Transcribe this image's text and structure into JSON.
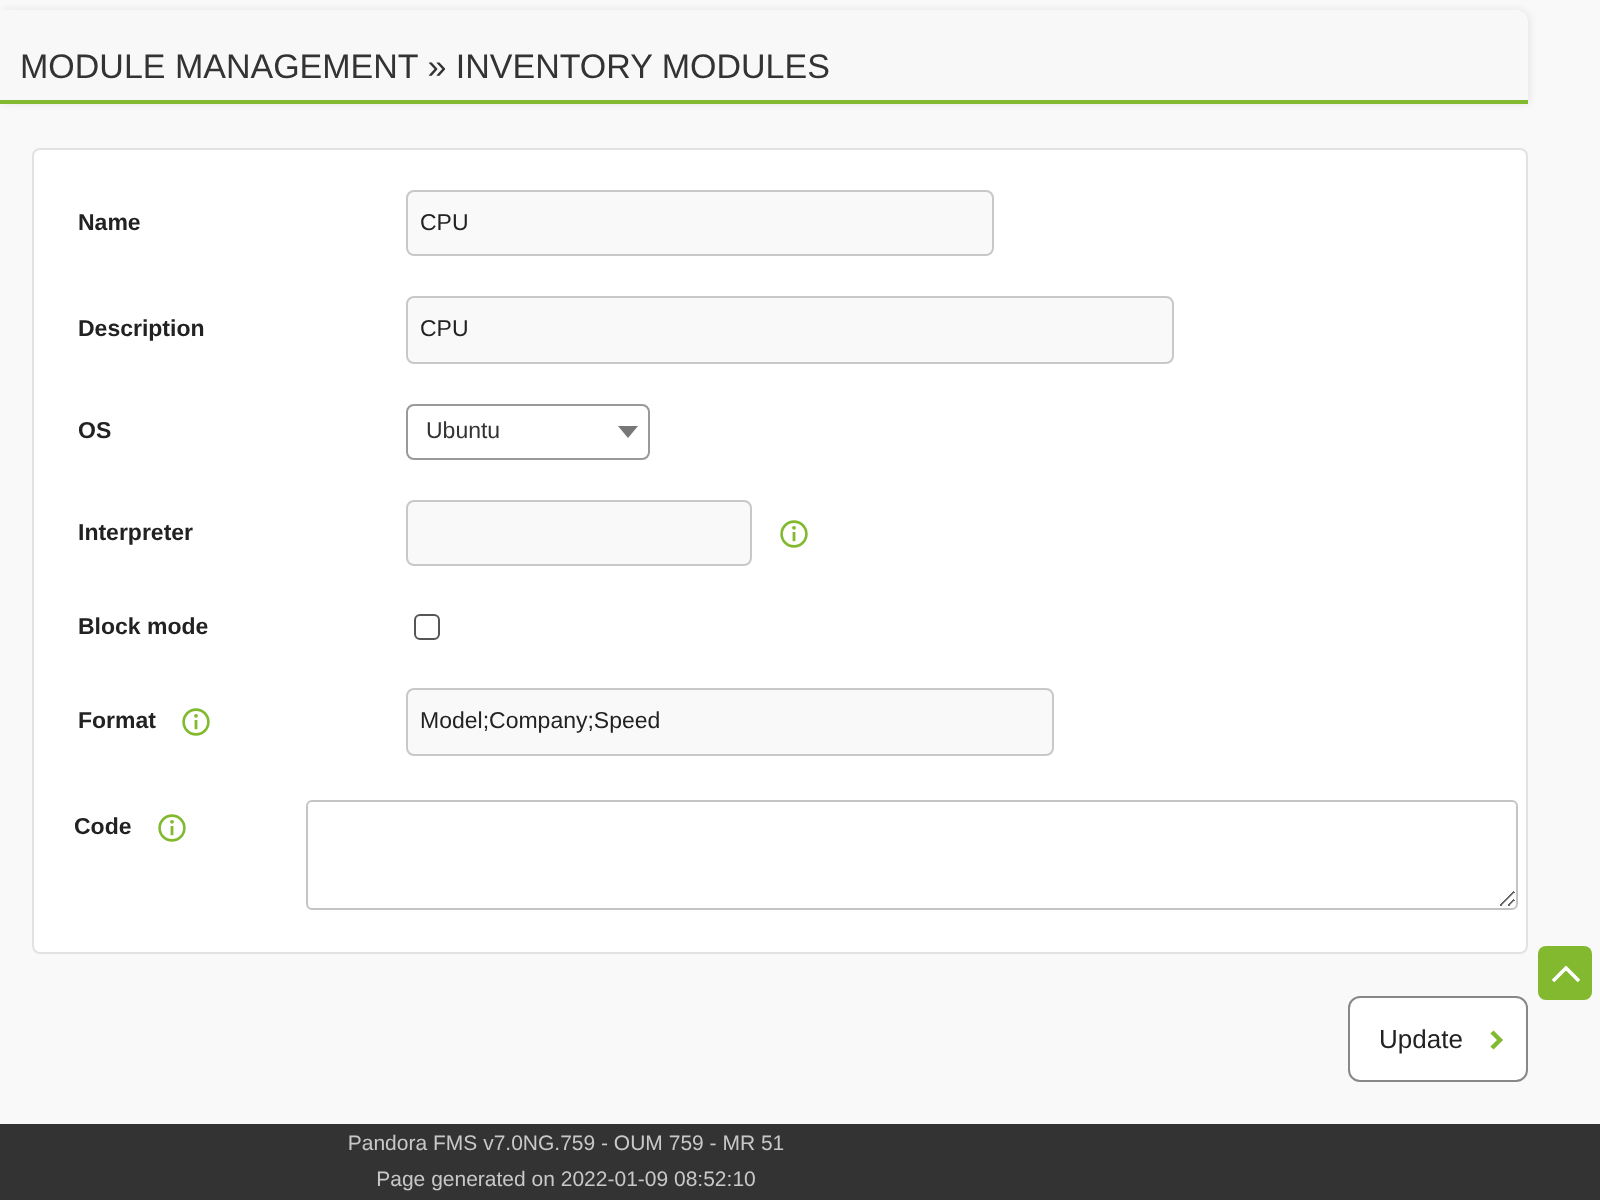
{
  "header": {
    "title": "MODULE MANAGEMENT » INVENTORY MODULES"
  },
  "form": {
    "fields": [
      {
        "kind": "text",
        "label": "Name",
        "value": "CPU"
      },
      {
        "kind": "text",
        "label": "Description",
        "value": "CPU"
      },
      {
        "kind": "select",
        "label": "OS",
        "value": "Ubuntu"
      },
      {
        "kind": "text",
        "label": "Interpreter",
        "field_help": true
      },
      {
        "kind": "checkbox",
        "label": "Block mode",
        "checked": false
      },
      {
        "kind": "text",
        "label": "Format",
        "label_help": true,
        "value": "Model;Company;Speed"
      },
      {
        "kind": "textarea",
        "label": "Code",
        "label_help": true
      }
    ]
  },
  "buttons": [
    {
      "label": "Update"
    }
  ],
  "footer": {
    "lines": [
      "Pandora FMS v7.0NG.759 - OUM 759 - MR 51",
      "Page generated on 2022-01-09 08:52:10"
    ]
  }
}
